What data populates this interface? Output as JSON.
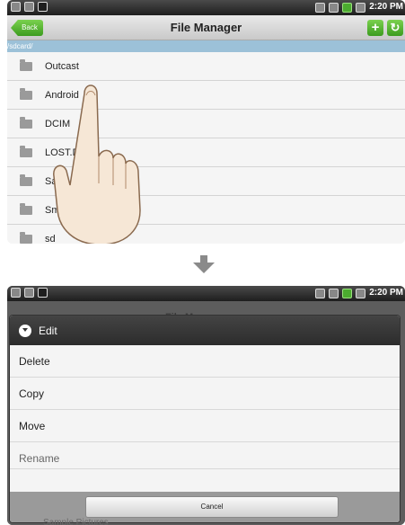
{
  "top_screen": {
    "status": {
      "time": "2:20 PM"
    },
    "titlebar": {
      "back_label": "Back",
      "title": "File Manager",
      "add_icon": "plus-icon",
      "refresh_icon": "refresh-icon"
    },
    "path": "/sdcard/",
    "files": [
      {
        "name": "Outcast"
      },
      {
        "name": "Android"
      },
      {
        "name": "DCIM"
      },
      {
        "name": "LOST.DIR"
      },
      {
        "name": "Sa"
      },
      {
        "name": "Sma"
      },
      {
        "name": "sd"
      }
    ]
  },
  "bottom_screen": {
    "status": {
      "time": "2:20 PM"
    },
    "behind_title": "File Manager",
    "behind_list_text": "Sample Pictures",
    "dialog": {
      "title": "Edit",
      "items": [
        {
          "label": "Delete"
        },
        {
          "label": "Copy"
        },
        {
          "label": "Move"
        },
        {
          "label": "Rename"
        }
      ],
      "cancel_label": "Cancel"
    }
  },
  "colors": {
    "accent_green": "#4bab2f",
    "path_bar": "#9cc1d8",
    "dialog_header": "#333333"
  }
}
